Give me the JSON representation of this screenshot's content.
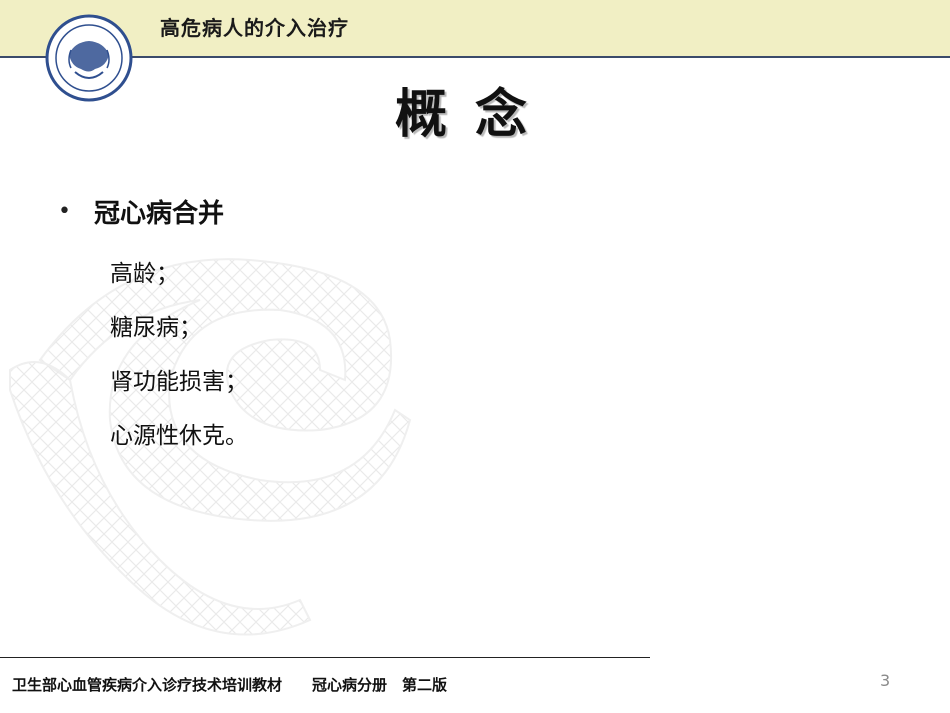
{
  "header": {
    "title": "高危病人的介入治疗"
  },
  "logo": {
    "icon": "ministry-of-health-seal-icon"
  },
  "slide": {
    "title": "概念",
    "bullet": "冠心病合并",
    "items": [
      "高龄；",
      "糖尿病；",
      "肾功能损害；",
      "心源性休克。"
    ]
  },
  "footer": {
    "text": "卫生部心血管疾病介入诊疗技术培训教材　　冠心病分册　第二版",
    "page_number": "3"
  },
  "colors": {
    "header_band": "#f1efc4",
    "header_rule": "#3b4b6b",
    "logo_blue": "#2f4f8f"
  }
}
